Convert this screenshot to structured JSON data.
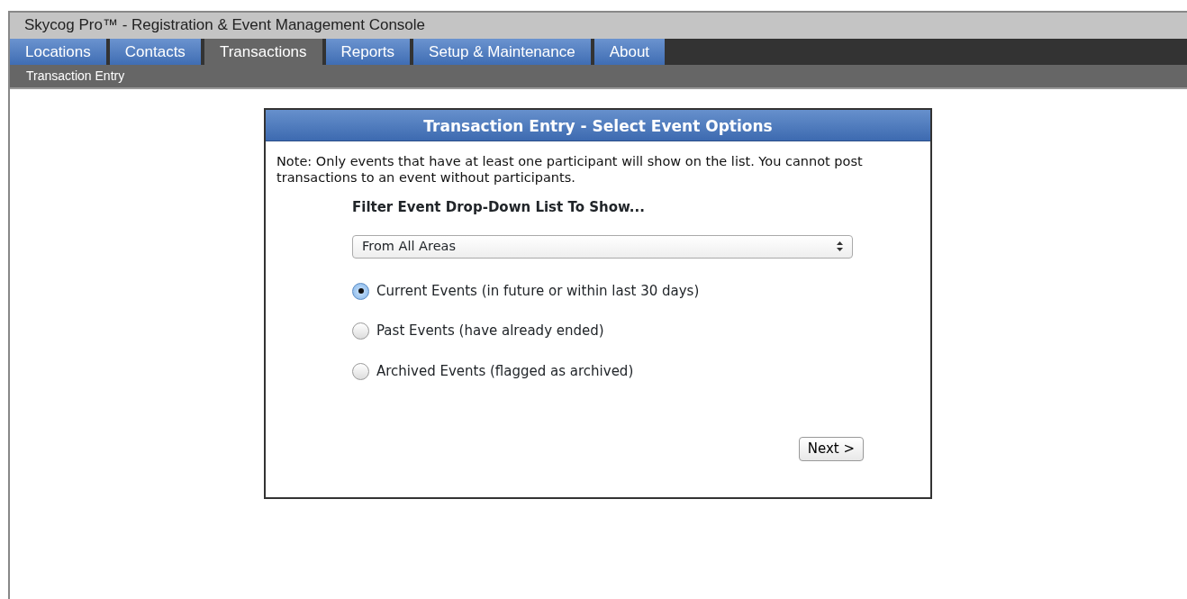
{
  "window": {
    "title": "Skycog Pro™ - Registration & Event Management Console"
  },
  "tabs": [
    {
      "label": "Locations",
      "selected": false
    },
    {
      "label": "Contacts",
      "selected": false
    },
    {
      "label": "Transactions",
      "selected": true
    },
    {
      "label": "Reports",
      "selected": false
    },
    {
      "label": "Setup & Maintenance",
      "selected": false
    },
    {
      "label": "About",
      "selected": false
    }
  ],
  "subnav": {
    "label": "Transaction Entry"
  },
  "panel": {
    "title": "Transaction Entry - Select Event Options",
    "note": "Note: Only events that have at least one participant will show on the list. You cannot post transactions to an event without participants.",
    "filter_label": "Filter Event Drop-Down List To Show...",
    "dropdown": {
      "value": "From All Areas"
    },
    "options": [
      {
        "label": "Current Events (in future or within last 30 days)",
        "selected": true
      },
      {
        "label": "Past Events (have already ended)",
        "selected": false
      },
      {
        "label": "Archived Events (flagged as archived)",
        "selected": false
      }
    ],
    "button": "Next >"
  }
}
